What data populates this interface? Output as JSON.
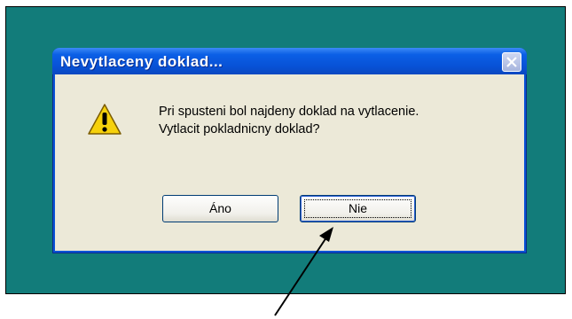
{
  "dialog": {
    "title": "Nevytlaceny doklad...",
    "message_line1": "Pri spusteni bol najdeny doklad na vytlacenie.",
    "message_line2": "Vytlacit pokladnicny doklad?",
    "yes_label": "Áno",
    "no_label": "Nie"
  },
  "icons": {
    "close": "close-icon",
    "warning": "warning-icon"
  },
  "colors": {
    "desktop": "#127c7a",
    "titlebar": "#0a52d6",
    "dialog_body": "#ece9d8"
  }
}
